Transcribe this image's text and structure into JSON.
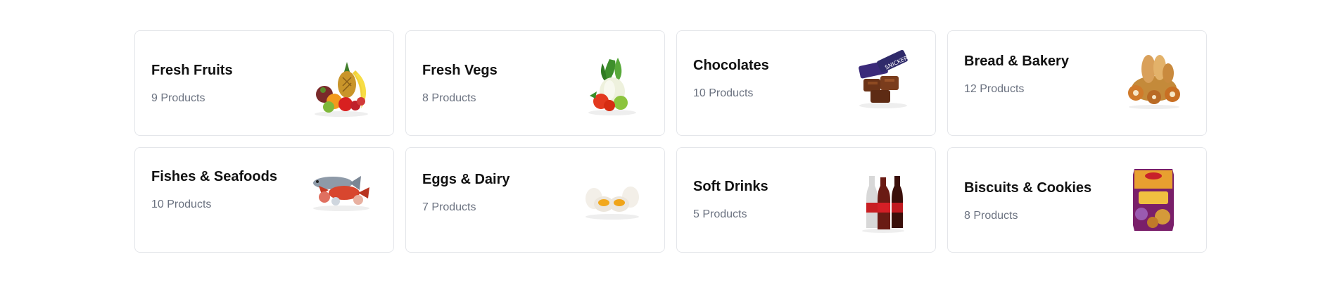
{
  "categories": [
    {
      "title": "Fresh Fruits",
      "count": "9 Products",
      "icon": "fruits-icon"
    },
    {
      "title": "Fresh Vegs",
      "count": "8 Products",
      "icon": "vegetables-icon"
    },
    {
      "title": "Chocolates",
      "count": "10 Products",
      "icon": "chocolate-icon"
    },
    {
      "title": "Bread & Bakery",
      "count": "12 Products",
      "icon": "bread-icon"
    },
    {
      "title": "Fishes & Seafoods",
      "count": "10 Products",
      "icon": "seafood-icon"
    },
    {
      "title": "Eggs & Dairy",
      "count": "7 Products",
      "icon": "eggs-icon"
    },
    {
      "title": "Soft Drinks",
      "count": "5 Products",
      "icon": "soft-drinks-icon"
    },
    {
      "title": "Biscuits & Cookies",
      "count": "8 Products",
      "icon": "biscuits-icon"
    }
  ]
}
